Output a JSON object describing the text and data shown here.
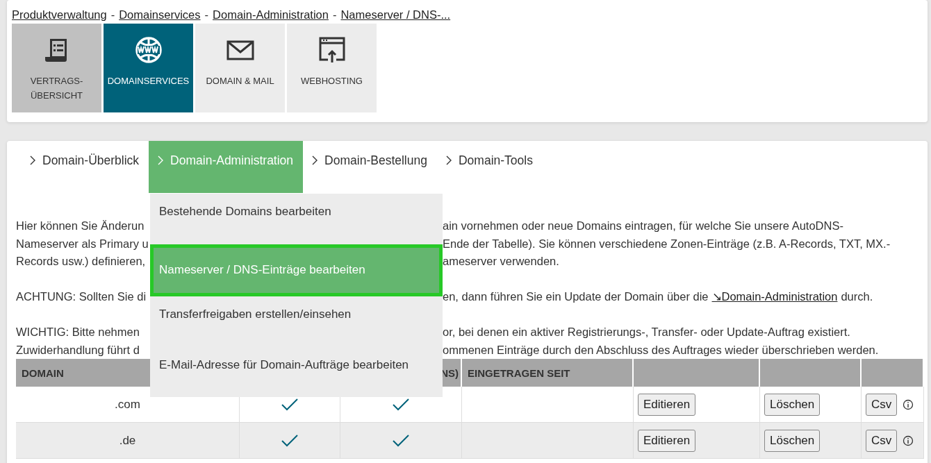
{
  "breadcrumb": [
    {
      "label": "Produktverwaltung"
    },
    {
      "separator": "-",
      "label": "Domainservices"
    },
    {
      "separator": "-",
      "label": "Domain-Administration"
    },
    {
      "separator": "-",
      "label": "Nameserver / DNS-..."
    }
  ],
  "tiles": [
    {
      "label": "VERTRAGS-\nÜBERSICHT",
      "kind": "contract",
      "selected": false,
      "hovered": true
    },
    {
      "label": "DOMAINSERVICES",
      "kind": "www",
      "selected": true,
      "hovered": false
    },
    {
      "label": "DOMAIN & MAIL",
      "kind": "mail",
      "selected": false,
      "hovered": false
    },
    {
      "label": "WEBHOSTING",
      "kind": "hosting",
      "selected": false,
      "hovered": false
    }
  ],
  "tabs": [
    {
      "label": "Domain-Überblick",
      "selected": false
    },
    {
      "label": "Domain-Administration",
      "selected": true
    },
    {
      "label": "Domain-Bestellung",
      "selected": false
    },
    {
      "label": "Domain-Tools",
      "selected": false
    }
  ],
  "dropdown": [
    {
      "label": "Bestehende Domains bearbeiten",
      "selected": false
    },
    {
      "label": "Nameserver / DNS-Einträge bearbeiten",
      "selected": true
    },
    {
      "label": "Transferfreigaben erstellen/einsehen",
      "selected": false
    },
    {
      "label": "E-Mail-Adresse für Domain-Aufträge bearbeiten",
      "selected": false
    }
  ],
  "paragraphs": [
    [
      {
        "left": "Hier können Sie Änderun",
        "right": "ain vornehmen oder neue Domains eintragen, für welche Sie unsere AutoDNS-"
      },
      {
        "left": "Nameserver als Primary u",
        "right": "Ende der Tabelle). Sie können verschiedene Zonen-Einträge (z.B. A-Records, TXT, MX.-"
      },
      {
        "left": "Records usw.) definieren,",
        "right": "ameserver verwenden."
      }
    ],
    [
      {
        "left": "ACHTUNG: Sollten Sie di",
        "right": "en, dann führen Sie ein Update der Domain über die",
        "link": "↘Domain-Administration",
        "after": "durch."
      }
    ],
    [
      {
        "left": "WICHTIG: Bitte nehmen",
        "right": "or, bei denen ein aktiver Registrierungs-, Transfer- oder Update-Auftrag existiert."
      },
      {
        "left": "Zuwiderhandlung führt d",
        "right": "ommenen Einträge durch den Abschluss des Auftrages wieder überschrieben werden."
      }
    ]
  ],
  "table": {
    "column_1": "DOMAIN",
    "column_3": "NS)",
    "column_4": "EINGETRAGEN SEIT",
    "rows": [
      {
        "domain": ".com",
        "column_2_checked": true,
        "column_3_checked": true,
        "buttons": [
          "Editieren",
          "Löschen",
          "Csv"
        ]
      },
      {
        "domain": ".de",
        "column_2_checked": true,
        "column_3_checked": true,
        "buttons": [
          "Editieren",
          "Löschen",
          "Csv"
        ]
      }
    ]
  }
}
